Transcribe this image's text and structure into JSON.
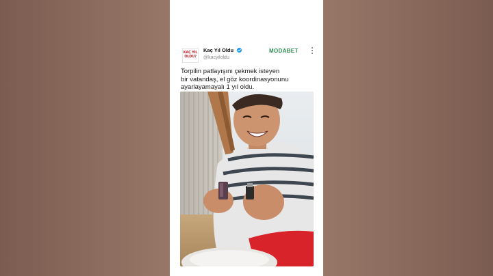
{
  "tweet": {
    "avatar_line1": "KAÇ YIL",
    "avatar_line2": "OLDU?",
    "author_name": "Kaç Yıl Oldu",
    "author_handle": "@kacyiloldu",
    "sponsor": "MODABET",
    "text_lines": [
      "Torpilin patlayışını çekmek isteyen",
      "bir vatandaş, el göz koordinasyonunu",
      "ayarlayamayalı 1 yıl oldu."
    ]
  },
  "colors": {
    "background_side": "#8b6b5d",
    "card": "#ffffff",
    "verified": "#1d9bf0",
    "sponsor": "#2f8a52"
  },
  "icons": {
    "verified": "verified-badge-icon",
    "more": "more-options-icon"
  }
}
